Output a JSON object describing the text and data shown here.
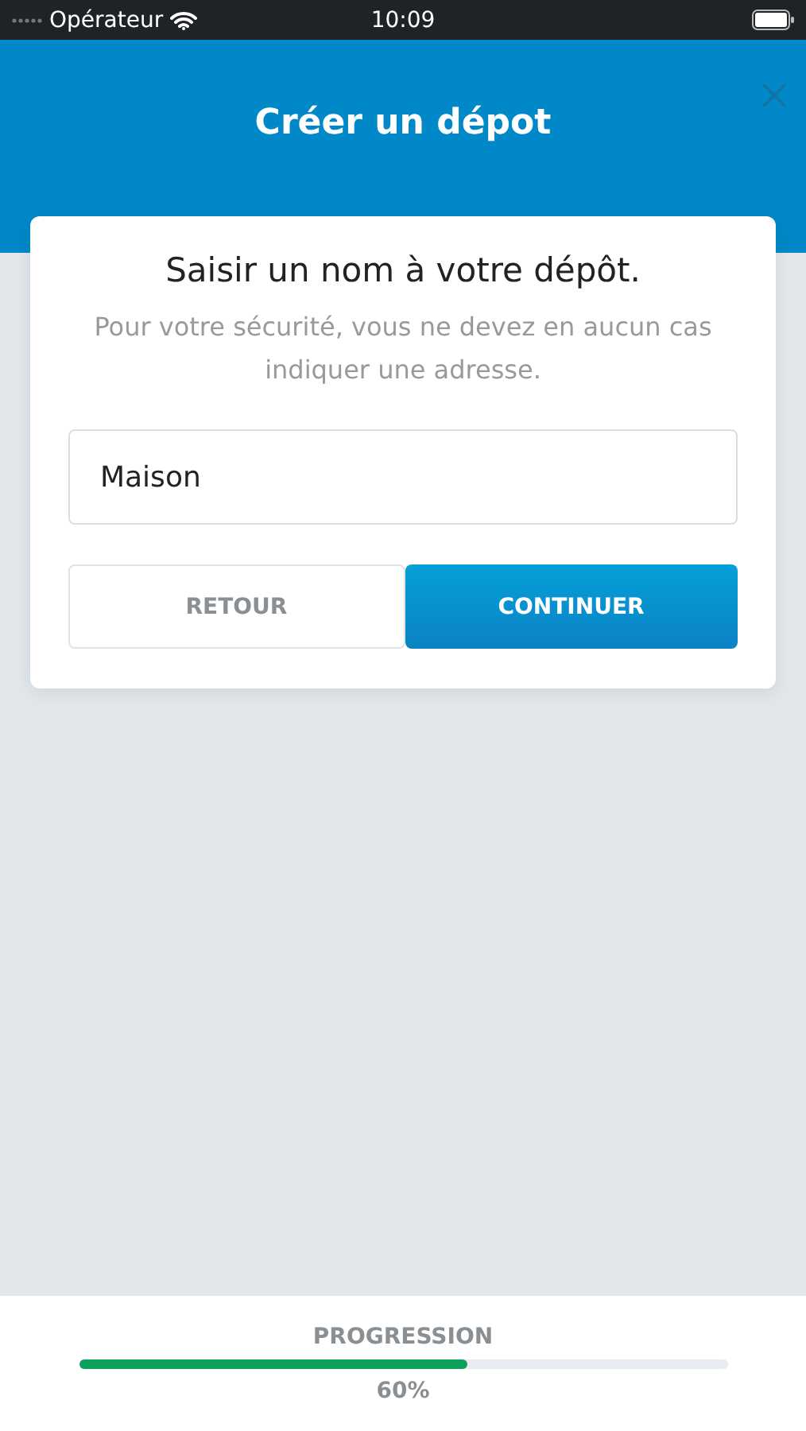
{
  "status_bar": {
    "carrier": "Opérateur",
    "time": "10:09"
  },
  "header": {
    "title": "Créer un dépot"
  },
  "card": {
    "heading": "Saisir un nom à votre dépôt.",
    "description": "Pour votre sécurité, vous ne devez en aucun cas indiquer une adresse.",
    "name_field": {
      "value": "Maison"
    },
    "buttons": [
      {
        "label": "RETOUR",
        "kind": "secondary"
      },
      {
        "label": "CONTINUER",
        "kind": "primary"
      }
    ]
  },
  "progress": {
    "label": "PROGRESSION",
    "level": 0.6,
    "reading": "60%"
  }
}
